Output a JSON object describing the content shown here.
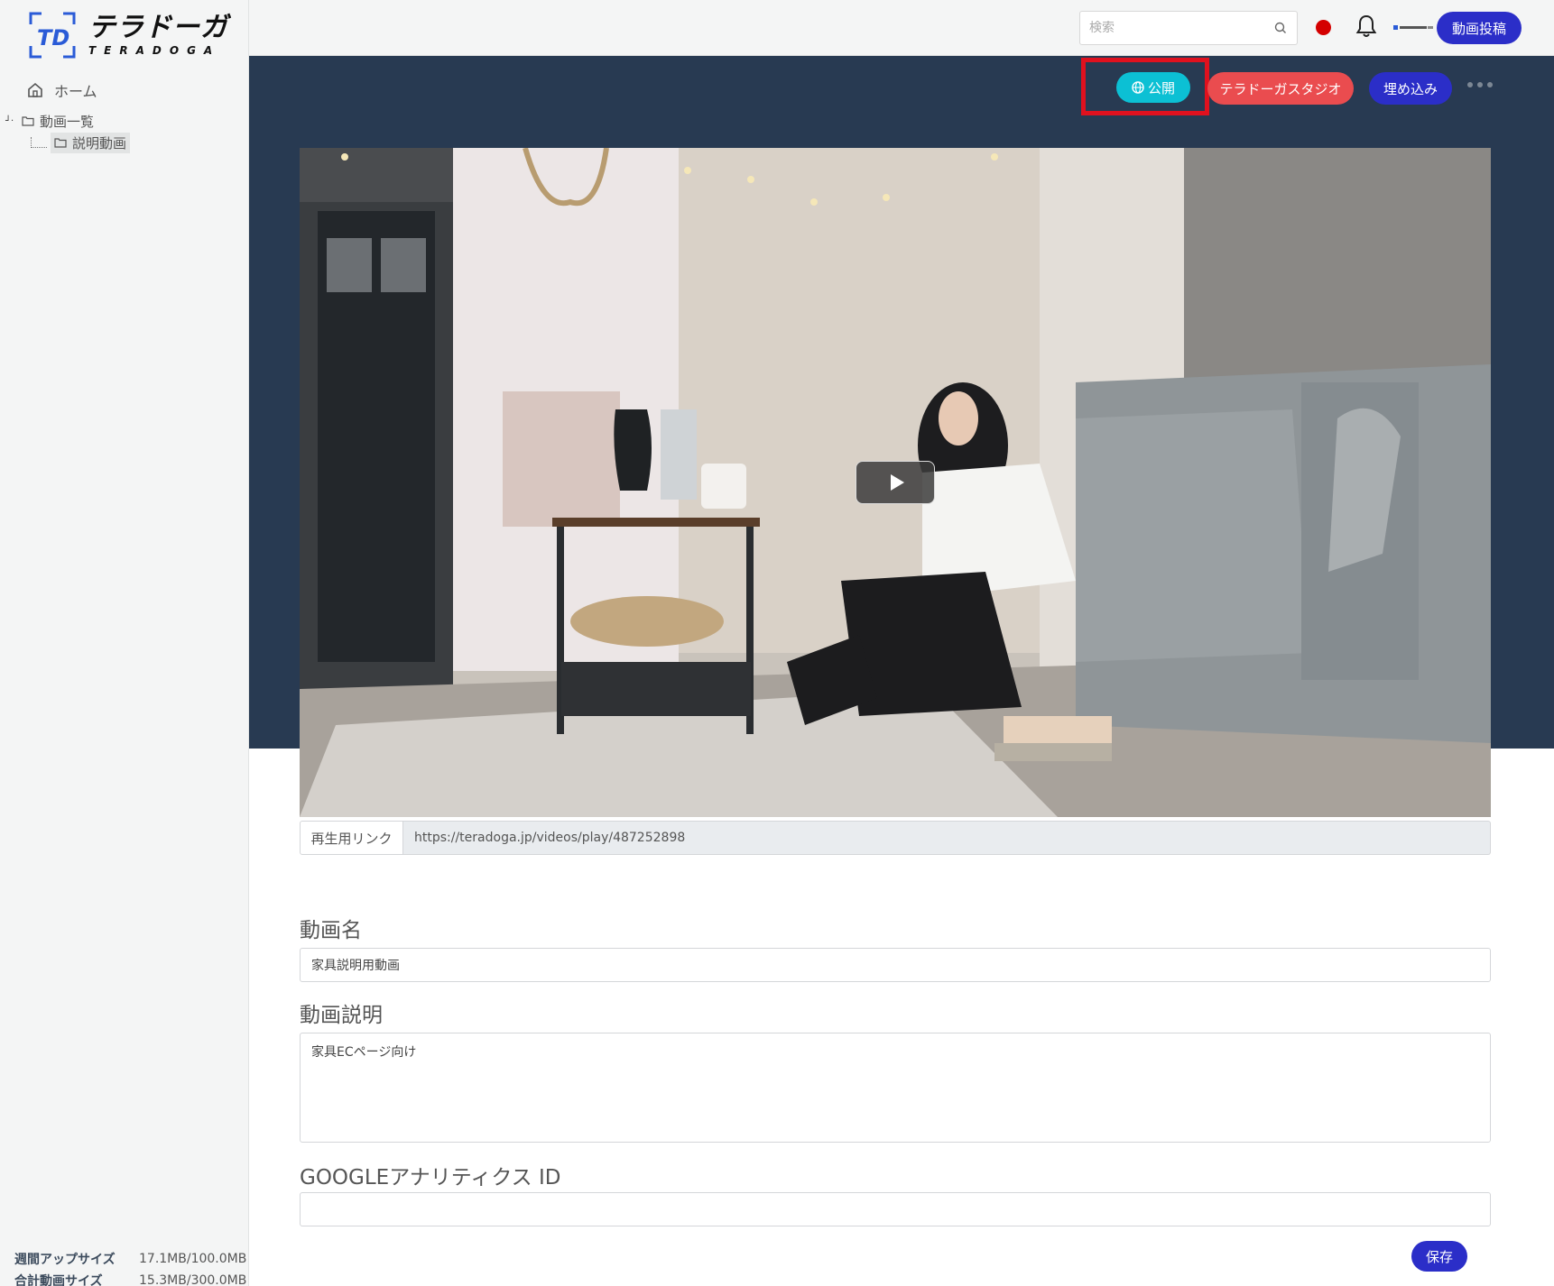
{
  "brand": {
    "logo_mark": "TD",
    "name_jp": "テラドーガ",
    "name_en": "TERADOGA"
  },
  "sidebar": {
    "home_label": "ホーム",
    "tree": {
      "root_label": "動画一覧",
      "child_label": "説明動画"
    },
    "usage": {
      "weekly_label": "週間アップサイズ",
      "weekly_value": "17.1MB/100.0MB",
      "total_label": "合計動画サイズ",
      "total_value": "15.3MB/300.0MB"
    }
  },
  "topbar": {
    "search_placeholder": "検索",
    "post_button": "動画投稿",
    "status_color": "#d40000"
  },
  "actions": {
    "publish": "公開",
    "studio": "テラドーガスタジオ",
    "embed": "埋め込み"
  },
  "video": {
    "play_icon": "play-icon"
  },
  "link": {
    "label": "再生用リンク",
    "url": "https://teradoga.jp/videos/play/487252898"
  },
  "form": {
    "title_label": "動画名",
    "title_value": "家具説明用動画",
    "description_label": "動画説明",
    "description_value": "家具ECページ向け",
    "ga_label": "GOOGLEアナリティクス ID",
    "ga_value": "",
    "save_button": "保存"
  },
  "colors": {
    "accent_blue": "#2b2ec8",
    "publish_cyan": "#0cc0d4",
    "studio_red": "#ea4c4f",
    "hero_bg": "#283a52",
    "highlight_red": "#e0111e"
  }
}
